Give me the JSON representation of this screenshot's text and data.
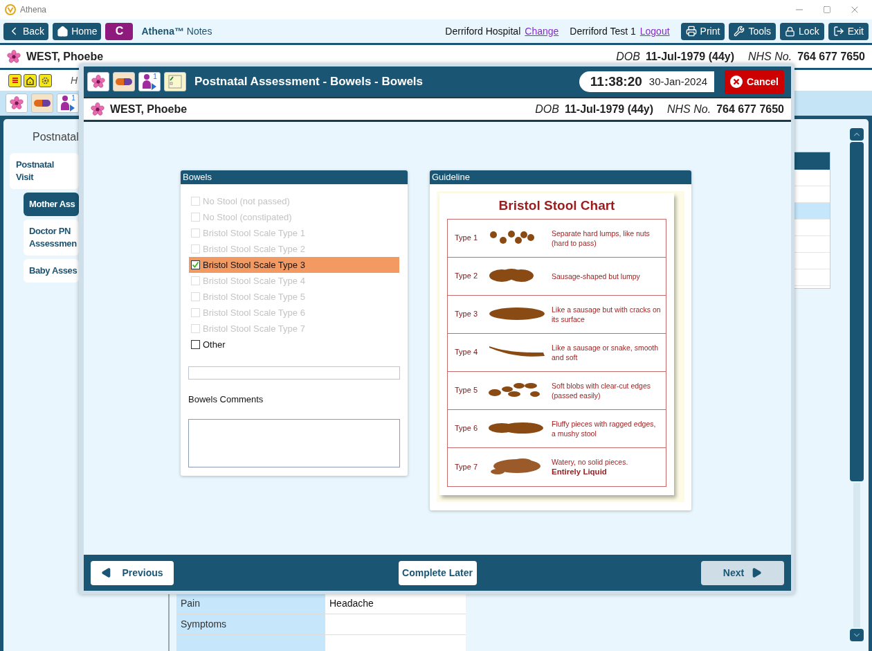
{
  "window": {
    "title": "Athena"
  },
  "toolbar": {
    "nav_buttons": [
      {
        "label": "Back",
        "kind": "back"
      },
      {
        "label": "Home",
        "kind": "home"
      },
      {
        "label": "C",
        "kind": "letter"
      }
    ],
    "app_name": "**Athena™** Notes",
    "location": "Derriford Hospital",
    "location_link": "Change",
    "user": "Derriford Test 1",
    "user_link": "Logout",
    "actions": [
      {
        "label": "Print",
        "kind": "print"
      },
      {
        "label": "Tools",
        "kind": "tools"
      },
      {
        "label": "Lock",
        "kind": "lock"
      },
      {
        "label": "Exit",
        "kind": "exit"
      }
    ]
  },
  "patient": {
    "name": "WEST, Phoebe",
    "dob_label": "DOB",
    "dob": "11-Jul-1979 (44y)",
    "nhs_label": "NHS No.",
    "nhs": "764 677 7650"
  },
  "info_row": {
    "partial_text": "H"
  },
  "quick_icons": {
    "badge": "1"
  },
  "sidebar": {
    "heading": "Postnatal",
    "items": [
      {
        "label": "Postnatal Visit",
        "selected": false,
        "children": [
          {
            "label": "Mother Ass",
            "selected": true
          },
          {
            "label": "Doctor PN Assessmen",
            "selected": false
          },
          {
            "label": "Baby Asses",
            "selected": false
          }
        ]
      }
    ]
  },
  "summary_table": {
    "rows": [
      {
        "label": "Pain",
        "value": "Headache"
      },
      {
        "label": "Symptoms"
      }
    ]
  },
  "modal": {
    "title": "Postnatal Assessment - Bowels - Bowels",
    "icon_badge": "1",
    "time": "11:38:20",
    "date": "30-Jan-2024",
    "cancel": "Cancel",
    "patient": {
      "name": "WEST, Phoebe",
      "dob_label": "DOB",
      "dob": "11-Jul-1979 (44y)",
      "nhs_label": "NHS No.",
      "nhs": "764 677 7650"
    },
    "bowels": {
      "heading": "Bowels",
      "options": [
        {
          "label": "No Stool (not passed)",
          "checked": false,
          "disabled": true
        },
        {
          "label": "No Stool (constipated)",
          "checked": false,
          "disabled": true
        },
        {
          "label": "Bristol Stool Scale Type 1",
          "checked": false,
          "disabled": true
        },
        {
          "label": "Bristol Stool Scale Type 2",
          "checked": false,
          "disabled": true
        },
        {
          "label": "Bristol Stool Scale Type 3",
          "checked": true,
          "disabled": false
        },
        {
          "label": "Bristol Stool Scale Type 4",
          "checked": false,
          "disabled": true
        },
        {
          "label": "Bristol Stool Scale Type 5",
          "checked": false,
          "disabled": true
        },
        {
          "label": "Bristol Stool Scale Type 6",
          "checked": false,
          "disabled": true
        },
        {
          "label": "Bristol Stool Scale Type 7",
          "checked": false,
          "disabled": true
        },
        {
          "label": "Other",
          "checked": false,
          "disabled": false
        }
      ],
      "comments_label": "Bowels Comments"
    },
    "guideline": {
      "heading": "Guideline",
      "chart_title": "Bristol Stool Chart",
      "types": [
        {
          "label": "Type 1",
          "description": "Separate hard lumps, like nuts (hard to pass)"
        },
        {
          "label": "Type 2",
          "description": "Sausage-shaped but lumpy"
        },
        {
          "label": "Type 3",
          "description": "Like a sausage but with cracks on its surface"
        },
        {
          "label": "Type 4",
          "description": "Like a sausage or snake, smooth and soft"
        },
        {
          "label": "Type 5",
          "description": "Soft blobs with clear-cut edges (passed easily)"
        },
        {
          "label": "Type 6",
          "description": "Fluffy pieces with ragged edges, a mushy stool"
        },
        {
          "label": "Type 7",
          "description": "Watery, no solid pieces.",
          "emphasis": "Entirely Liquid"
        }
      ]
    },
    "footer": {
      "previous": "Previous",
      "complete_later": "Complete Later",
      "next": {
        "label": "Next",
        "disabled": true
      }
    }
  }
}
